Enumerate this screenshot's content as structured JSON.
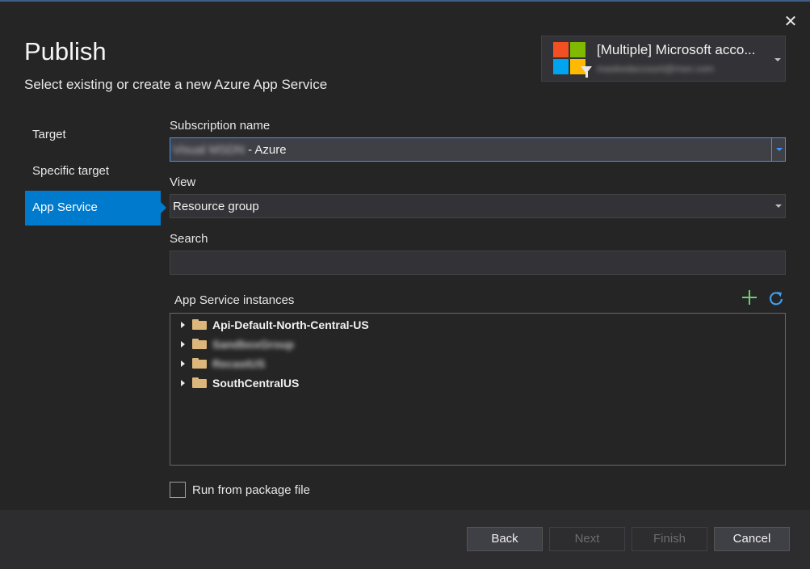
{
  "dialog": {
    "title": "Publish",
    "subtitle": "Select existing or create a new Azure App Service",
    "close_glyph": "✕"
  },
  "account": {
    "name": "[Multiple] Microsoft acco...",
    "email": "maskedaccount@msn.com",
    "logo_colors": [
      "#f25022",
      "#7fba00",
      "#00a4ef",
      "#ffb900"
    ]
  },
  "nav": {
    "items": [
      {
        "label": "Target",
        "active": false
      },
      {
        "label": "Specific target",
        "active": false
      },
      {
        "label": "App Service",
        "active": true
      }
    ]
  },
  "form": {
    "subscription_label": "Subscription name",
    "subscription_value_hidden": "Visual MSDN",
    "subscription_value_suffix": " - Azure",
    "view_label": "View",
    "view_value": "Resource group",
    "search_label": "Search",
    "search_value": "",
    "instances_label": "App Service instances"
  },
  "tree": {
    "items": [
      {
        "label": "Api-Default-North-Central-US",
        "blurred": false
      },
      {
        "label": "SandboxGroup",
        "blurred": true
      },
      {
        "label": "RecastUS",
        "blurred": true
      },
      {
        "label": "SouthCentralUS",
        "blurred": false
      }
    ]
  },
  "options": {
    "run_from_package_label": "Run from package file",
    "run_from_package_checked": false
  },
  "footer": {
    "back": "Back",
    "next": "Next",
    "finish": "Finish",
    "cancel": "Cancel"
  },
  "colors": {
    "accent": "#007acc",
    "focus_border": "#3399ff",
    "add_icon": "#6fcf6f",
    "refresh_icon": "#3e9dee",
    "folder": "#dcb67a"
  }
}
